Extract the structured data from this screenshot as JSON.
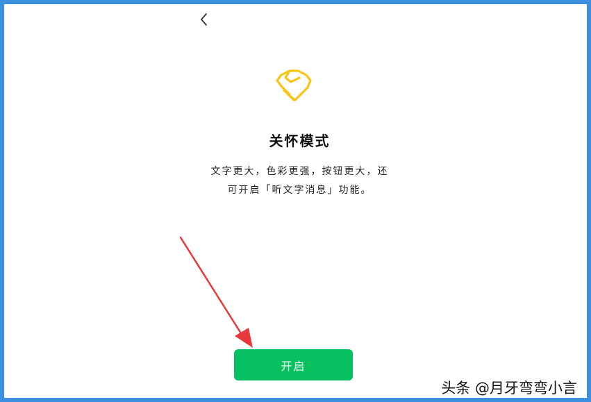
{
  "nav": {
    "back_icon": "chevron-left-icon"
  },
  "logo": {
    "icon": "heart-hand-icon",
    "color": "#f5c518"
  },
  "content": {
    "title": "关怀模式",
    "description_line1": "文字更大，色彩更强，按钮更大，还",
    "description_line2": "可开启「听文字消息」功能。"
  },
  "actions": {
    "open_label": "开启",
    "open_color": "#07c160"
  },
  "annotation": {
    "arrow_color": "#e8383d"
  },
  "watermark": {
    "text": "头条 @月牙弯弯小言"
  }
}
